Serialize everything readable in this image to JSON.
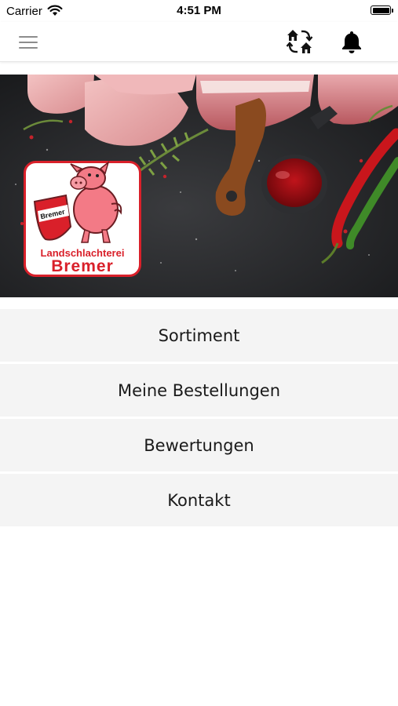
{
  "status_bar": {
    "carrier": "Carrier",
    "time": "4:51 PM",
    "icons": [
      "wifi-icon",
      "battery-icon"
    ]
  },
  "nav_bar": {
    "icons": [
      "hamburger-menu-icon",
      "switch-store-icon",
      "bell-icon"
    ]
  },
  "banner": {
    "logo": {
      "line1": "Landschlachterei",
      "line2": "Bremer",
      "shield_text": "Bremer",
      "brand_color": "#d9202a"
    }
  },
  "menu": {
    "items": [
      {
        "label": "Sortiment"
      },
      {
        "label": "Meine Bestellungen"
      },
      {
        "label": "Bewertungen"
      },
      {
        "label": "Kontakt"
      }
    ]
  },
  "colors": {
    "menu_item_bg": "#f4f4f4",
    "nav_icon_gray": "#8c8c8c",
    "banner_dark": "#1e1f22"
  }
}
